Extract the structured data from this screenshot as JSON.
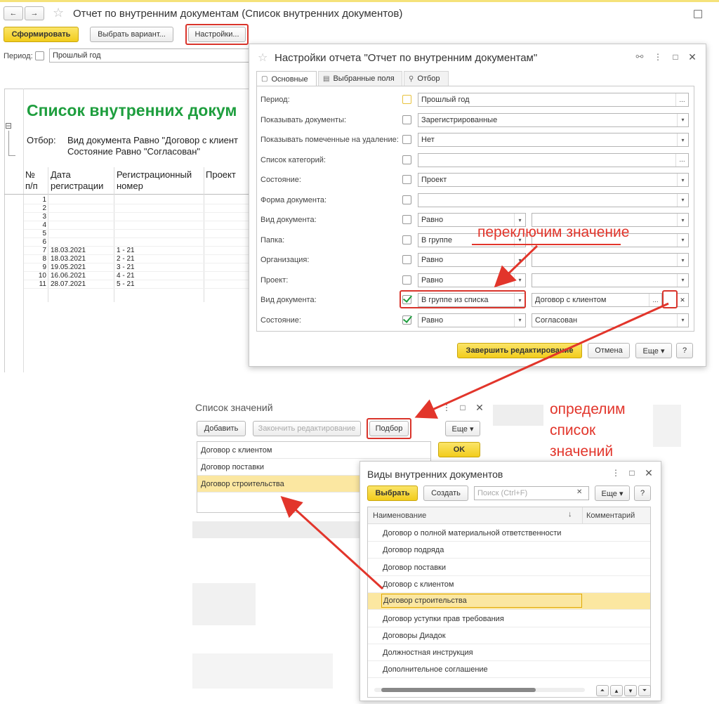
{
  "main": {
    "title": "Отчет по внутренним документам (Список внутренних документов)",
    "nav_back": "←",
    "nav_forward": "→",
    "star": "☆",
    "form_button": "Сформировать",
    "variant_button": "Выбрать вариант...",
    "settings_button": "Настройки...",
    "period_label": "Период:",
    "period_value": "Прошлый год",
    "collapse": "⊟"
  },
  "report": {
    "heading": "Список внутренних докум",
    "filter_label": "Отбор:",
    "filter_line1": "Вид документа Равно \"Договор с клиент",
    "filter_line2": "Состояние Равно \"Согласован\"",
    "columns": [
      "№ п/п",
      "Дата регистрации",
      "Регистрационный номер",
      "Проект"
    ],
    "rows": [
      {
        "n": "1",
        "date": "",
        "num": ""
      },
      {
        "n": "2",
        "date": "",
        "num": ""
      },
      {
        "n": "3",
        "date": "",
        "num": ""
      },
      {
        "n": "4",
        "date": "",
        "num": ""
      },
      {
        "n": "5",
        "date": "",
        "num": ""
      },
      {
        "n": "6",
        "date": "",
        "num": ""
      },
      {
        "n": "7",
        "date": "18.03.2021",
        "num": "1 - 21"
      },
      {
        "n": "8",
        "date": "18.03.2021",
        "num": "2 - 21"
      },
      {
        "n": "9",
        "date": "19.05.2021",
        "num": "3 - 21"
      },
      {
        "n": "10",
        "date": "16.06.2021",
        "num": "4 - 21"
      },
      {
        "n": "11",
        "date": "28.07.2021",
        "num": "5 - 21"
      }
    ]
  },
  "settings": {
    "title": "Настройки отчета \"Отчет по внутренним документам\"",
    "tabs": [
      "Основные",
      "Выбранные поля",
      "Отбор"
    ],
    "rows": [
      {
        "label": "Период:",
        "checked": false,
        "value": "Прошлый год",
        "kind": "dots"
      },
      {
        "label": "Показывать документы:",
        "checked": false,
        "value": "Зарегистрированные",
        "kind": "dd"
      },
      {
        "label": "Показывать помеченные на удаление:",
        "checked": false,
        "value": "Нет",
        "kind": "dd"
      },
      {
        "label": "Список категорий:",
        "checked": false,
        "value": "",
        "kind": "dots"
      },
      {
        "label": "Состояние:",
        "checked": false,
        "value": "Проект",
        "kind": "dd"
      },
      {
        "label": "Форма документа:",
        "checked": false,
        "value": "",
        "kind": "dd"
      },
      {
        "label": "Вид документа:",
        "checked": false,
        "value": "Равно",
        "kind": "split",
        "value2": ""
      },
      {
        "label": "Папка:",
        "checked": false,
        "value": "В группе",
        "kind": "split",
        "value2": ""
      },
      {
        "label": "Организация:",
        "checked": false,
        "value": "Равно",
        "kind": "split",
        "value2": ""
      },
      {
        "label": "Проект:",
        "checked": false,
        "value": "Равно",
        "kind": "split",
        "value2": ""
      },
      {
        "label": "Вид документа:",
        "checked": true,
        "value": "В группе из списка",
        "kind": "split-dots",
        "value2": "Договор с клиентом"
      },
      {
        "label": "Состояние:",
        "checked": true,
        "value": "Равно",
        "kind": "split",
        "value2": "Согласован"
      }
    ],
    "finish_button": "Завершить редактирование",
    "cancel_button": "Отмена",
    "more_button": "Еще ▾",
    "help_button": "?"
  },
  "annotations": {
    "switch": "переключим значение",
    "define_line1": "определим",
    "define_line2": "список",
    "define_line3": "значений"
  },
  "value_list": {
    "title": "Список значений",
    "add_button": "Добавить",
    "finish_button": "Закончить редактирование",
    "pick_button": "Подбор",
    "more_button": "Еще ▾",
    "ok_button": "OK",
    "items": [
      "Договор с клиентом",
      "Договор поставки",
      "Договор строительства"
    ]
  },
  "doc_types": {
    "title": "Виды внутренних документов",
    "select_button": "Выбрать",
    "create_button": "Создать",
    "search_placeholder": "Поиск (Ctrl+F)",
    "more_button": "Еще ▾",
    "help_button": "?",
    "col_name": "Наименование",
    "col_comment": "Комментарий",
    "items": [
      "Договор о полной материальной ответственности",
      "Договор подряда",
      "Договор поставки",
      "Договор с клиентом",
      "Договор строительства",
      "Договор уступки прав требования",
      "Договоры Диадок",
      "Должностная инструкция",
      "Дополнительное соглашение"
    ]
  },
  "colors": {
    "accent_yellow": "#f5d12a",
    "annotation_red": "#e2352b",
    "heading_green": "#1e9e3e",
    "selected_row": "#fbe7a1"
  }
}
